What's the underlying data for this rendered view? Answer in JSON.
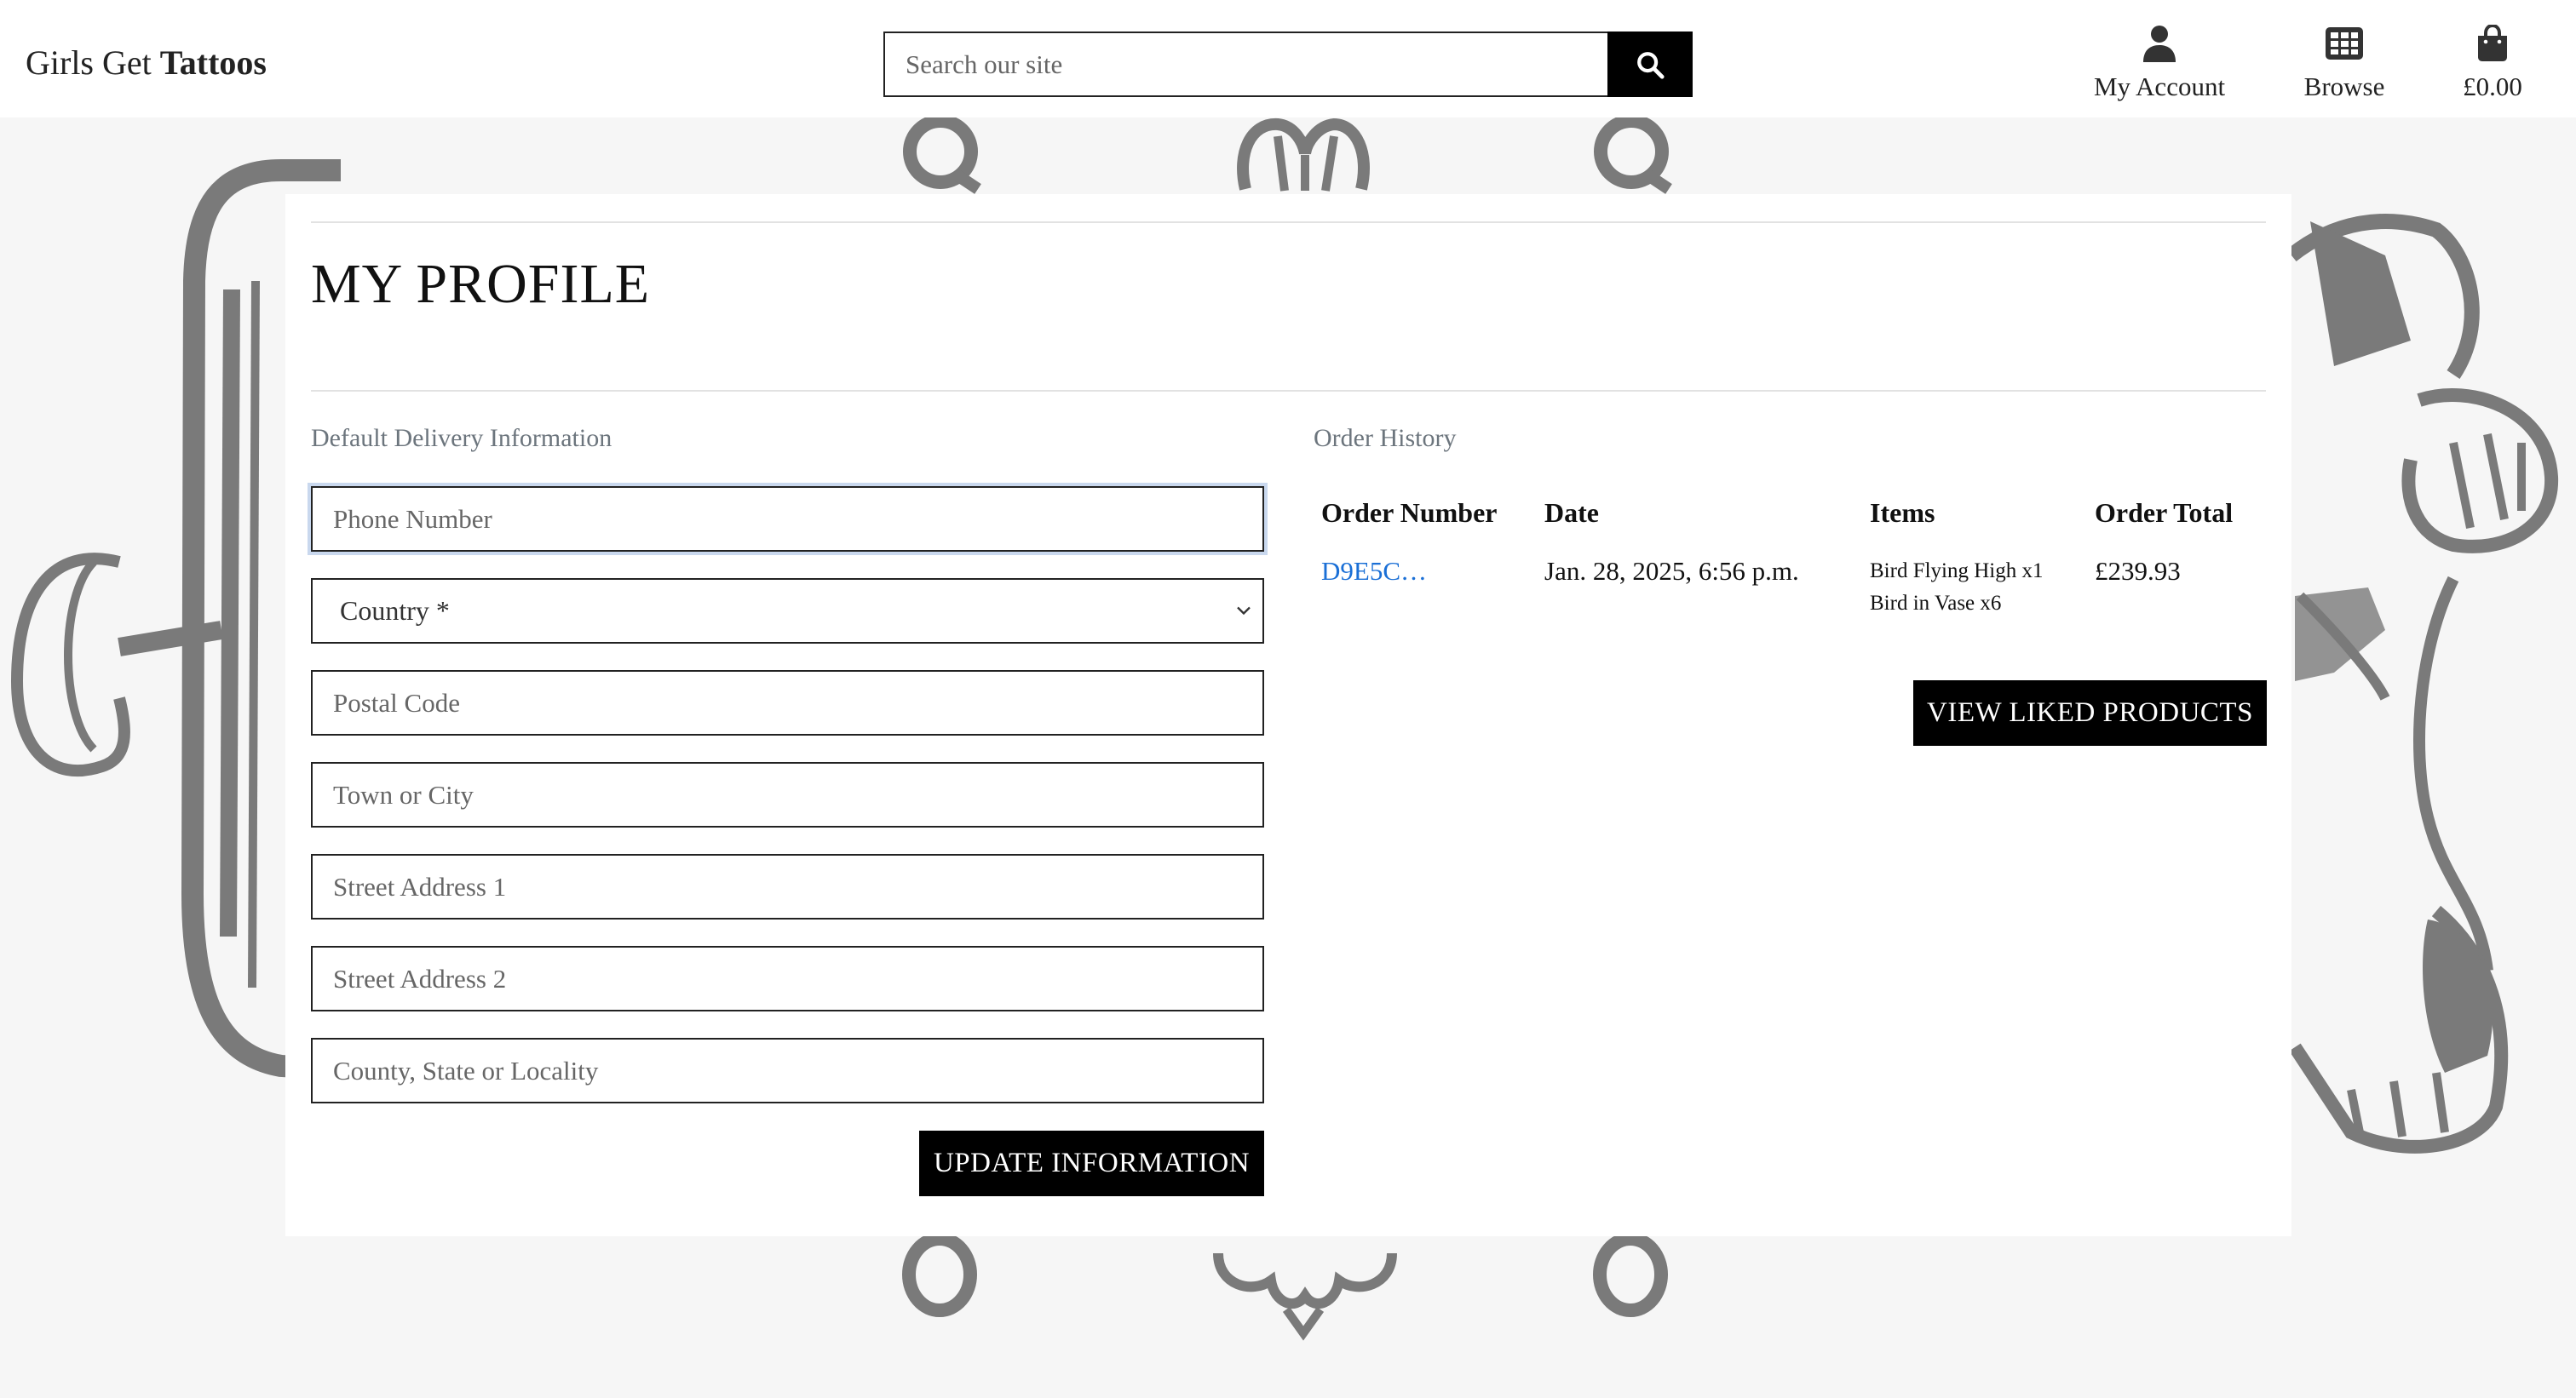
{
  "header": {
    "brand_regular": "Girls Get",
    "brand_bold": "Tattoos",
    "search": {
      "placeholder": "Search our site",
      "icon": "search-icon"
    },
    "nav": {
      "account_label": "My Account",
      "browse_label": "Browse",
      "bag_total": "£0.00"
    }
  },
  "profile": {
    "title": "MY PROFILE",
    "delivery": {
      "heading": "Default Delivery Information",
      "phone_placeholder": "Phone Number",
      "country_value": "Country *",
      "postal_placeholder": "Postal Code",
      "town_placeholder": "Town or City",
      "street1_placeholder": "Street Address 1",
      "street2_placeholder": "Street Address 2",
      "county_placeholder": "County, State or Locality",
      "update_button": "UPDATE INFORMATION"
    },
    "history": {
      "heading": "Order History",
      "columns": [
        "Order Number",
        "Date",
        "Items",
        "Order Total"
      ],
      "orders": [
        {
          "number": "D9E5C…",
          "date": "Jan. 28, 2025, 6:56 p.m.",
          "items": [
            "Bird Flying High x1",
            "Bird in Vase x6"
          ],
          "total": "£239.93"
        }
      ],
      "liked_button": "VIEW LIKED PRODUCTS"
    }
  },
  "colors": {
    "accent_link": "#1a6fd6",
    "button_bg": "#000000",
    "muted_text": "#6c757d",
    "background": "#f6f6f6",
    "illustration_gray": "#7a7a7a"
  }
}
